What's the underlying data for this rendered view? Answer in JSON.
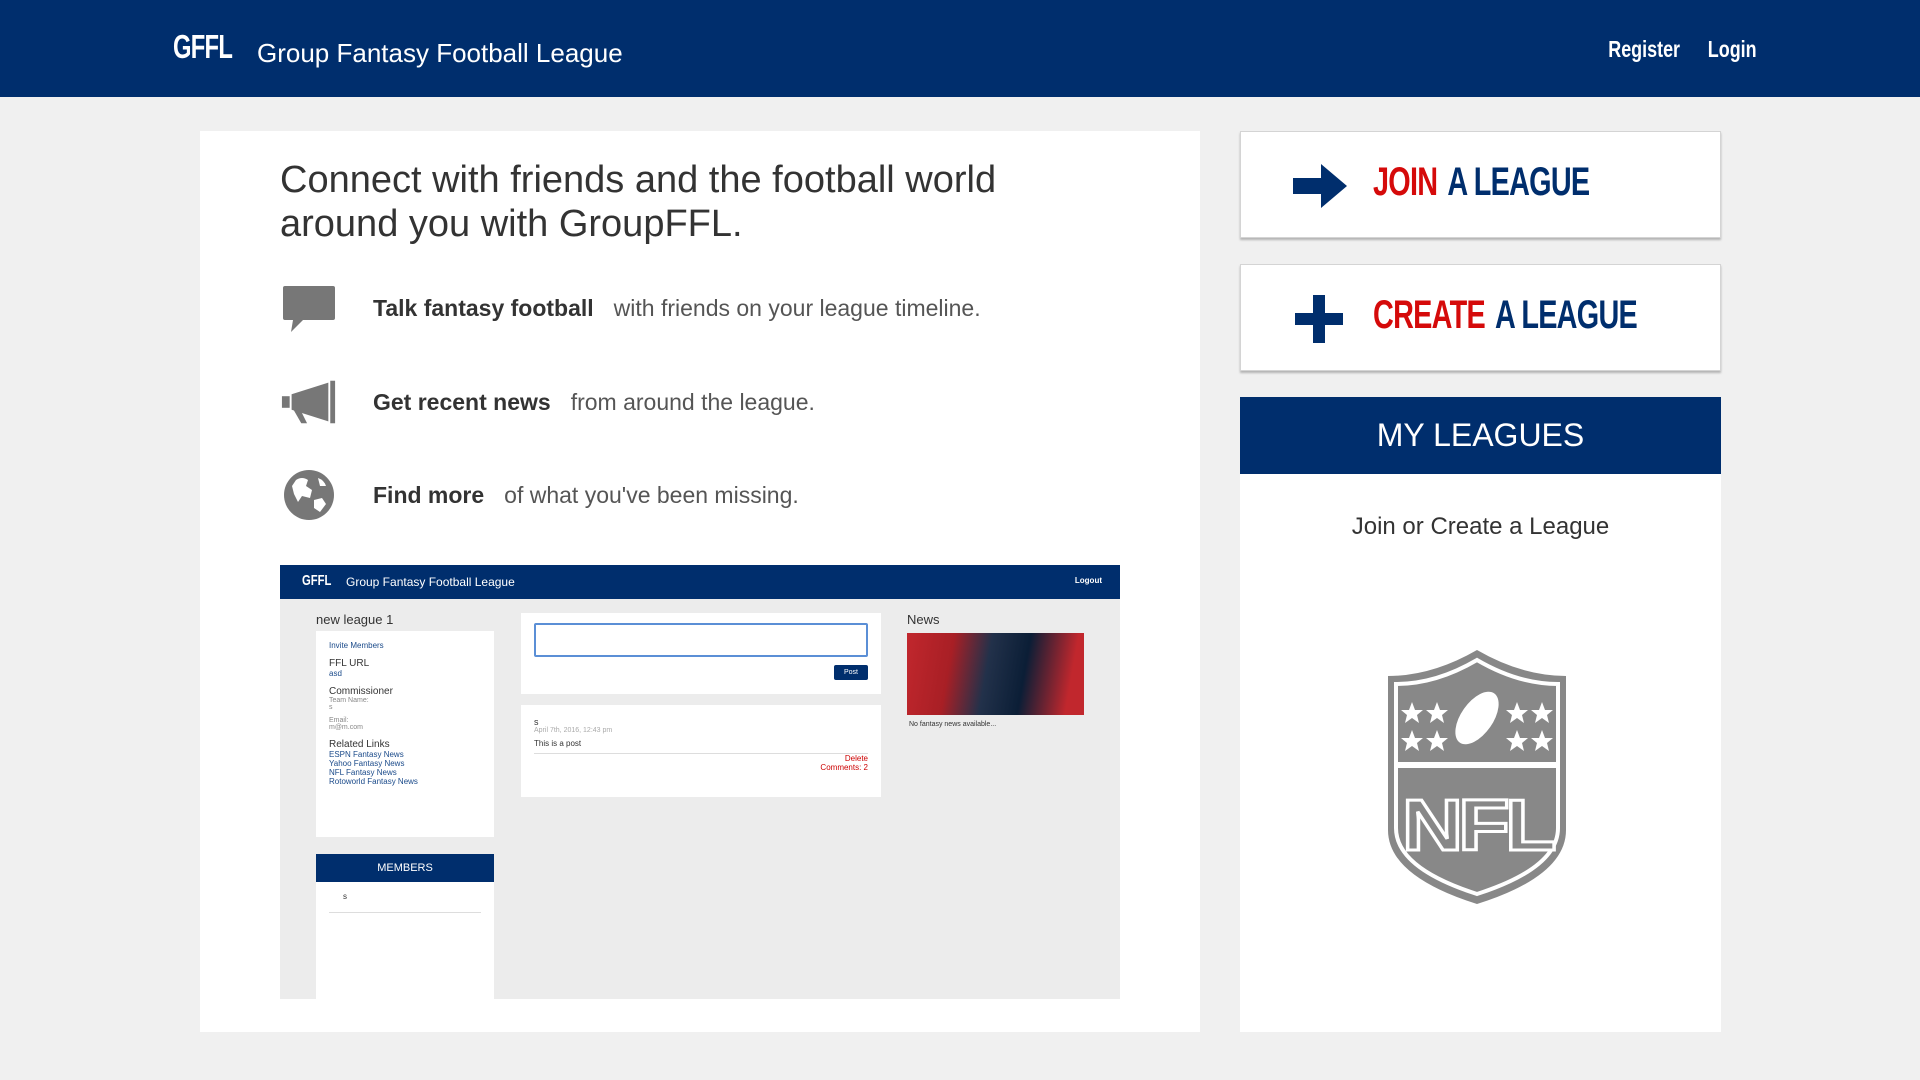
{
  "header": {
    "brand": "GFFL",
    "title": "Group Fantasy Football League",
    "register": "Register",
    "login": "Login"
  },
  "intro": {
    "headline": "Connect with friends and the football world around you with GroupFFL.",
    "features": [
      {
        "icon": "speech-bubble-icon",
        "bold": "Talk fantasy football",
        "text": "with friends on your league timeline."
      },
      {
        "icon": "megaphone-icon",
        "bold": "Get recent news",
        "text": "from around the league."
      },
      {
        "icon": "globe-icon",
        "bold": "Find more",
        "text": "of what you've been missing."
      }
    ]
  },
  "preview": {
    "brand": "GFFL",
    "title": "Group Fantasy Football League",
    "logout": "Logout",
    "league_name": "new league 1",
    "invite": "Invite Members",
    "ffl_url_label": "FFL URL",
    "ffl_url_value": "asd",
    "commissioner_label": "Commissioner",
    "team_name_label": "Team Name:",
    "team_name_value": "s",
    "email_label": "Email:",
    "email_value": "m@m.com",
    "related_label": "Related Links",
    "links": [
      "ESPN Fantasy News",
      "Yahoo Fantasy News",
      "NFL Fantasy News",
      "Rotoworld Fantasy News"
    ],
    "members_header": "MEMBERS",
    "member": "s",
    "post_button": "Post",
    "post_author": "s",
    "post_date": "April 7th, 2016, 12:43 pm",
    "post_text": "This is a post",
    "post_delete": "Delete",
    "post_comments": "Comments: 2",
    "news_title": "News",
    "news_empty": "No fantasy news available..."
  },
  "actions": {
    "join_red": "JOIN",
    "join_blue": "A LEAGUE",
    "create_red": "CREATE",
    "create_blue": "A LEAGUE"
  },
  "my_leagues": {
    "header": "MY LEAGUES",
    "empty_text": "Join or Create a League"
  },
  "colors": {
    "navy": "#002e6d",
    "red": "#d50a0a",
    "icon_gray": "#777777"
  }
}
